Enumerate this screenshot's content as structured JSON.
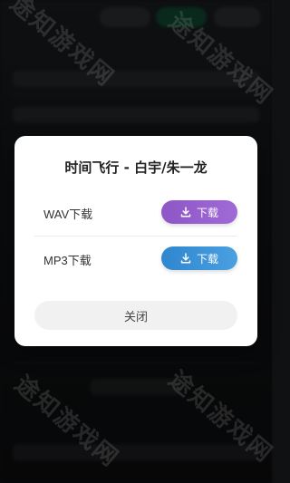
{
  "dialog": {
    "title": "时间飞行 - 白宇/朱一龙",
    "items": [
      {
        "label": "WAV下载",
        "button_label": "下载",
        "icon": "download-icon"
      },
      {
        "label": "MP3下载",
        "button_label": "下载",
        "icon": "download-icon"
      }
    ],
    "close_label": "关闭"
  },
  "watermark": {
    "text": "途知游戏网"
  },
  "colors": {
    "wav_button": "#9b5fcf",
    "mp3_button": "#3a92d8",
    "dialog_bg": "#ffffff",
    "close_bg": "#f1f1f1"
  }
}
